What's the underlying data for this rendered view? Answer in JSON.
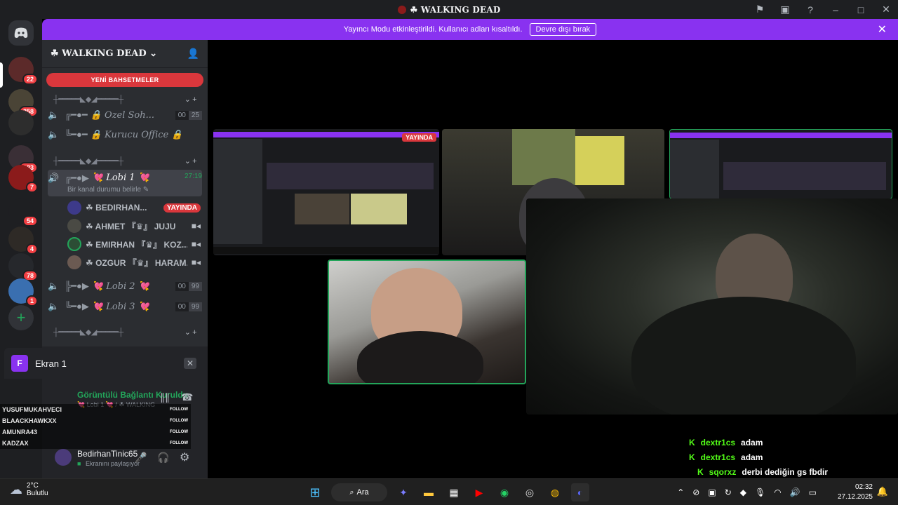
{
  "window": {
    "title": "☘ WALKING DEAD"
  },
  "banner": {
    "message": "Yayıncı Modu etkinleştirildi. Kullanıcı adları kısaltıldı.",
    "button": "Devre dışı bırak"
  },
  "rail": {
    "badges": [
      "22",
      "358",
      "183",
      "7",
      "54",
      "4",
      "78",
      "1"
    ]
  },
  "guild": {
    "name": "☘ WALKING DEAD ⌄",
    "mentions_label": "YENİ BAHSETMELER",
    "separators": [
      "┼━━━━━◣◆◢━━━━━┼",
      "┼━━━━━◣◆◢━━━━━┼",
      "┼━━━━━◣◆◢━━━━━┼"
    ],
    "channels": [
      {
        "prefix": "╔━●━",
        "name": "🔒 Özel Soh...",
        "count_a": "00",
        "count_b": "25"
      },
      {
        "prefix": "╚━●━",
        "name": "🔒 Kurucu Office 🔒",
        "count_a": "",
        "count_b": ""
      },
      {
        "prefix": "╔━●▶",
        "name": "💘 Lobi 1 💘",
        "count_a": "27:19",
        "count_b": ""
      },
      {
        "prefix": "╠━●▶",
        "name": "💘 Lobi 2 💘",
        "count_a": "00",
        "count_b": "99"
      },
      {
        "prefix": "╚━●▶",
        "name": "💘 Lobi 3 💘",
        "count_a": "00",
        "count_b": "99"
      }
    ],
    "lobi1_sub": "Bir kanal durumu belirle ✎",
    "users": [
      {
        "name": "☘ BEDIRHAN...",
        "live": "YAYINDA"
      },
      {
        "name": "☘ AHMET 『♛』 JUJU",
        "live": ""
      },
      {
        "name": "☘ EMIRHAN 『♛』 KOZ...",
        "live": ""
      },
      {
        "name": "☘ OZGUR 『♛』 HARAM...",
        "live": ""
      }
    ]
  },
  "popover": {
    "icon_letter": "F",
    "label": "Ekran 1"
  },
  "voice": {
    "status": "Görüntülü Bağlantı Kuruldu",
    "sub": "💘 Lobi 1 💘 / ☘ WALKING",
    "account": "BedirhanTinic65",
    "account_sub": "Ekranını paylaşıyor"
  },
  "followers": [
    {
      "name": "YUSUFMUKAHVECI",
      "label": "FOLLOW"
    },
    {
      "name": "BLAACKHAWKXX",
      "label": "FOLLOW"
    },
    {
      "name": "AMUNRA43",
      "label": "FOLLOW"
    },
    {
      "name": "KADZAX",
      "label": "FOLLOW"
    }
  ],
  "stage": {
    "live_label": "YAYINDA"
  },
  "chat": [
    {
      "user": "dextr1cs",
      "text": "adam"
    },
    {
      "user": "dextr1cs",
      "text": "adam"
    },
    {
      "user": "sqorxz",
      "text": "derbi dediğin gs fbdir"
    }
  ],
  "taskbar": {
    "temp": "2°C",
    "weather": "Bulutlu",
    "search": "Ara",
    "time": "02:32",
    "date": "27.12.2025"
  }
}
